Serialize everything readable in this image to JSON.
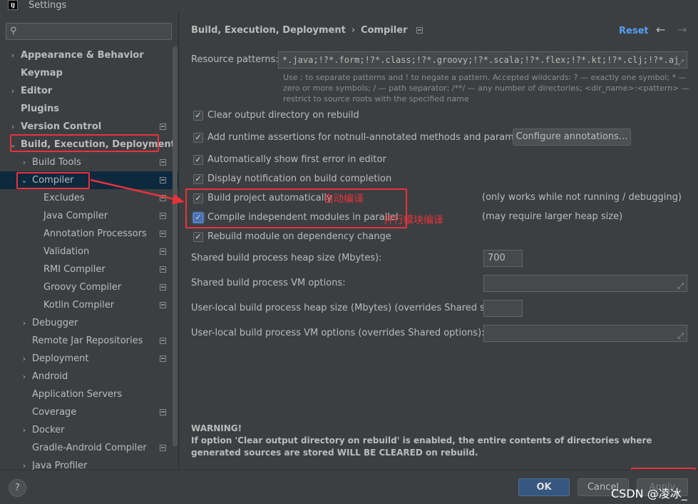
{
  "window": {
    "title": "Settings",
    "app_icon_text": "IJ"
  },
  "search": {
    "placeholder": ""
  },
  "sidebar": {
    "items": [
      {
        "label": "Appearance & Behavior"
      },
      {
        "label": "Keymap"
      },
      {
        "label": "Editor"
      },
      {
        "label": "Plugins"
      },
      {
        "label": "Version Control"
      },
      {
        "label": "Build, Execution, Deployment"
      },
      {
        "label": "Build Tools"
      },
      {
        "label": "Compiler"
      },
      {
        "label": "Excludes"
      },
      {
        "label": "Java Compiler"
      },
      {
        "label": "Annotation Processors"
      },
      {
        "label": "Validation"
      },
      {
        "label": "RMI Compiler"
      },
      {
        "label": "Groovy Compiler"
      },
      {
        "label": "Kotlin Compiler"
      },
      {
        "label": "Debugger"
      },
      {
        "label": "Remote Jar Repositories"
      },
      {
        "label": "Deployment"
      },
      {
        "label": "Android"
      },
      {
        "label": "Application Servers"
      },
      {
        "label": "Coverage"
      },
      {
        "label": "Docker"
      },
      {
        "label": "Gradle-Android Compiler"
      },
      {
        "label": "Java Profiler"
      }
    ]
  },
  "header": {
    "breadcrumb_parent": "Build, Execution, Deployment",
    "breadcrumb_sep": "›",
    "breadcrumb_current": "Compiler",
    "reset": "Reset",
    "back_icon": "←",
    "forward_icon": "→"
  },
  "resource_patterns": {
    "label": "Resource patterns:",
    "value": "*.java;!?*.form;!?*.class;!?*.groovy;!?*.scala;!?*.flex;!?*.kt;!?*.clj;!?*.aj",
    "hint": "Use ; to separate patterns and ! to negate a pattern. Accepted wildcards: ? — exactly one symbol; * — zero or more symbols; / — path separator; /**/ — any number of directories; <dir_name>:<pattern> — restrict to source roots with the specified name"
  },
  "options": {
    "clear_output": {
      "label": "Clear output directory on rebuild",
      "checked": true
    },
    "runtime_assertions": {
      "label": "Add runtime assertions for notnull-annotated methods and parameters",
      "checked": true
    },
    "configure_annotations": "Configure annotations...",
    "show_first_error": {
      "label": "Automatically show first error in editor",
      "checked": true
    },
    "display_notification": {
      "label": "Display notification on build completion",
      "checked": true
    },
    "build_automatically": {
      "label": "Build project automatically",
      "checked": true,
      "note": "(only works while not running / debugging)"
    },
    "compile_parallel": {
      "label": "Compile independent modules in parallel",
      "checked": true,
      "note": "(may require larger heap size)"
    },
    "rebuild_on_dependency": {
      "label": "Rebuild module on dependency change",
      "checked": true
    }
  },
  "fields": {
    "heap_label": "Shared build process heap size (Mbytes):",
    "heap_value": "700",
    "vm_label": "Shared build process VM options:",
    "vm_value": "",
    "user_heap_label": "User-local build process heap size (Mbytes) (overrides Shared size):",
    "user_heap_value": "",
    "user_vm_label": "User-local build process VM options (overrides Shared options):",
    "user_vm_value": ""
  },
  "warning": {
    "title": "WARNING!",
    "text": "If option 'Clear output directory on rebuild' is enabled, the entire contents of directories where generated sources are stored WILL BE CLEARED on rebuild."
  },
  "annotations": {
    "auto_compile": "自动编译",
    "parallel_compile": "并行模块编译"
  },
  "footer": {
    "help": "?",
    "ok": "OK",
    "cancel": "Cancel",
    "apply": "Apply",
    "watermark": "CSDN @凌冰_"
  },
  "colors": {
    "background": "#3c3f41",
    "selection": "#4b6eaf",
    "link": "#589df6",
    "annotation_red": "#e8323c",
    "ok_button": "#365880"
  }
}
